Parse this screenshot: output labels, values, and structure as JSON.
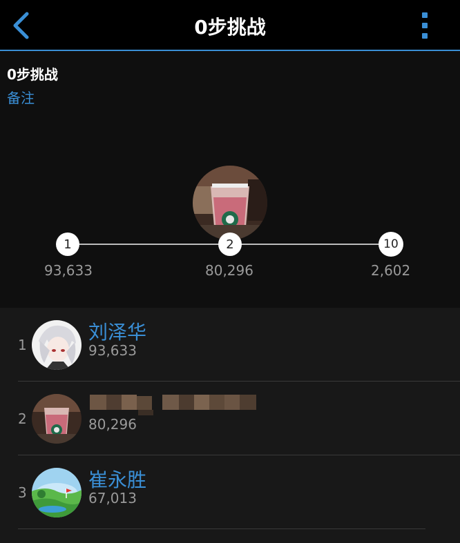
{
  "header": {
    "title": "0步挑战",
    "back_icon": "chevron-left-icon",
    "menu_icon": "more-vertical-icon"
  },
  "challenge": {
    "name": "0步挑战",
    "note_link": "备注",
    "milestones": [
      {
        "rank": "1",
        "steps": "93,633"
      },
      {
        "rank": "2",
        "steps": "80,296"
      },
      {
        "rank": "10",
        "steps": "2,602"
      }
    ]
  },
  "leaderboard": [
    {
      "rank": "1",
      "name": "刘泽华",
      "steps": "93,633",
      "avatar": "anime-avatar"
    },
    {
      "rank": "2",
      "name": "",
      "steps": "80,296",
      "avatar": "coffee-cup-avatar",
      "name_blurred": true
    },
    {
      "rank": "3",
      "name": "崔永胜",
      "steps": "67,013",
      "avatar": "golf-course-avatar"
    }
  ],
  "colors": {
    "accent": "#3a8fd6",
    "background": "#181818",
    "header_bg": "#000000",
    "secondary_text": "#9a9a9a"
  }
}
